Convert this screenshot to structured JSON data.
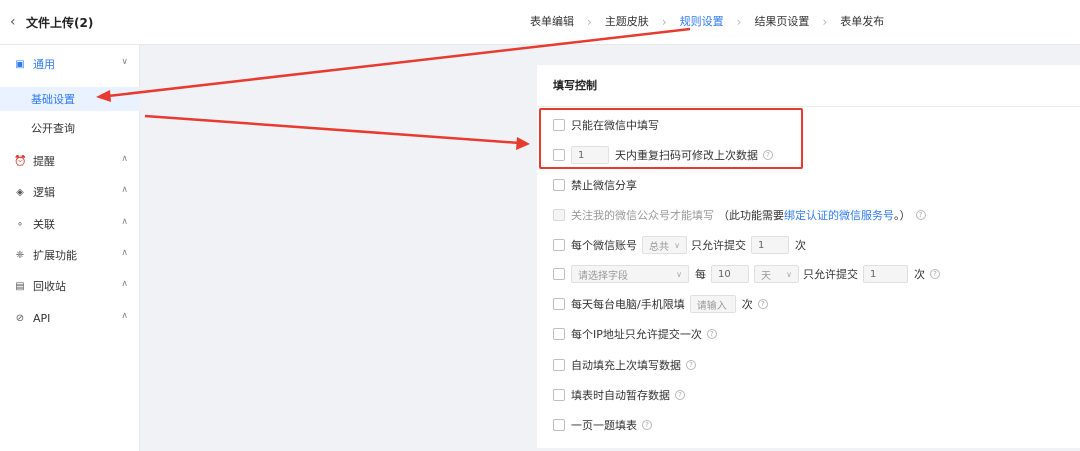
{
  "header": {
    "back_icon": "chevron-left-icon",
    "title": "文件上传(2)",
    "steps": [
      {
        "label": "表单编辑",
        "active": false
      },
      {
        "label": "主题皮肤",
        "active": false
      },
      {
        "label": "规则设置",
        "active": true
      },
      {
        "label": "结果页设置",
        "active": false
      },
      {
        "label": "表单发布",
        "active": false
      }
    ]
  },
  "sidebar": {
    "groups": [
      {
        "label": "通用",
        "icon": "form-icon",
        "expanded": true,
        "children": [
          {
            "label": "基础设置",
            "active": true
          },
          {
            "label": "公开查询",
            "active": false
          }
        ]
      },
      {
        "label": "提醒",
        "icon": "alarm-icon"
      },
      {
        "label": "逻辑",
        "icon": "layers-icon"
      },
      {
        "label": "关联",
        "icon": "link-icon"
      },
      {
        "label": "扩展功能",
        "icon": "gift-icon"
      },
      {
        "label": "回收站",
        "icon": "trash-icon"
      },
      {
        "label": "API",
        "icon": "compass-icon"
      }
    ]
  },
  "card": {
    "title": "填写控制",
    "only_wechat": "只能在微信中填写",
    "repeat_scan": {
      "days_value": "1",
      "suffix": "天内重复扫码可修改上次数据"
    },
    "no_share": "禁止微信分享",
    "follow_account": {
      "prefix": "关注我的微信公众号才能填写",
      "note_prefix": "（此功能需要",
      "link": "绑定认证的微信服务号",
      "note_suffix": "。）"
    },
    "per_account": {
      "prefix": "每个微信账号",
      "scope": "总共",
      "middle": "只允许提交",
      "count": "1",
      "unit": "次"
    },
    "per_field": {
      "placeholder": "请选择字段",
      "every": "每",
      "period_value": "10",
      "period_unit": "天",
      "middle": "只允许提交",
      "count": "1",
      "unit": "次"
    },
    "per_device": {
      "prefix": "每天每台电脑/手机限填",
      "placeholder": "请输入",
      "unit": "次"
    },
    "per_ip": "每个IP地址只允许提交一次",
    "autofill_last": "自动填充上次填写数据",
    "autosave_draft": "填表时自动暂存数据",
    "one_per_page": "一页一题填表"
  },
  "annotations": {
    "color": "#e83a2f"
  }
}
